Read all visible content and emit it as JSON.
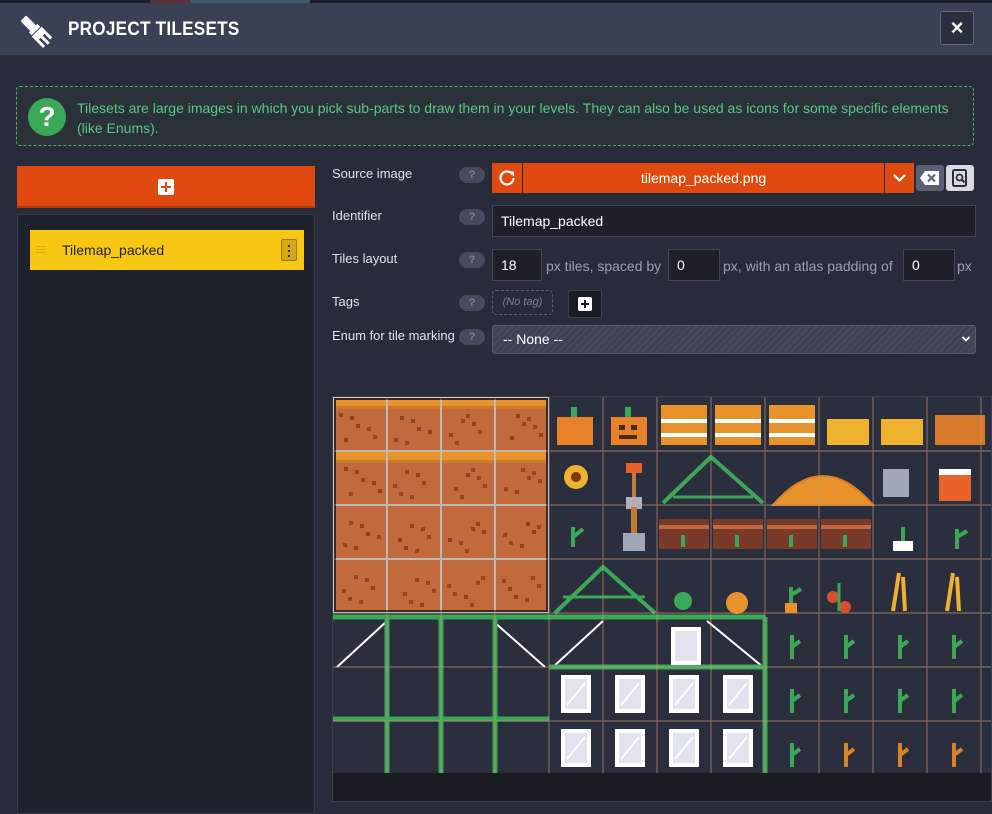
{
  "header": {
    "title": "PROJECT TILESETS",
    "close_label": "×"
  },
  "info": {
    "icon_text": "?",
    "text": "Tilesets are large images in which you pick sub-parts to draw them in your levels. They can also be used as icons for some specific elements (like Enums)."
  },
  "tileset_list": {
    "items": [
      {
        "label": "Tilemap_packed"
      }
    ]
  },
  "form": {
    "help_text": "?",
    "source_image": {
      "label": "Source image",
      "file": "tilemap_packed.png"
    },
    "identifier": {
      "label": "Identifier",
      "value": "Tilemap_packed"
    },
    "tiles_layout": {
      "label": "Tiles layout",
      "tile_size": "18",
      "text_px_tiles": "px tiles, spaced by",
      "spacing": "0",
      "text_atlas_padding": "px, with an atlas padding of",
      "padding": "0",
      "text_px": "px"
    },
    "tags": {
      "label": "Tags",
      "placeholder": "(No tag)"
    },
    "enum_marking": {
      "label": "Enum for tile marking",
      "selected": "-- None --"
    }
  },
  "colors": {
    "accent": "#e04a10",
    "selected_item": "#f7c714",
    "info_green": "#56c882"
  }
}
